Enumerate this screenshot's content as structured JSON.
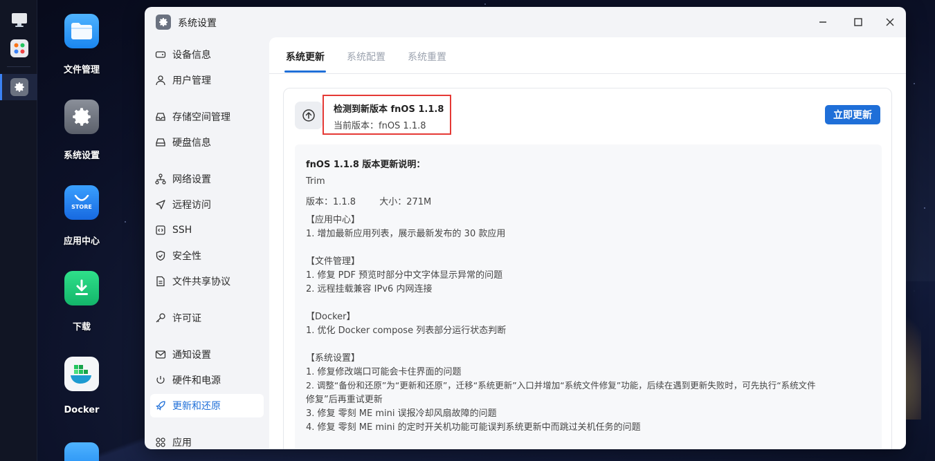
{
  "desktop": {
    "icons": [
      {
        "label": "文件管理"
      },
      {
        "label": "系统设置"
      },
      {
        "label": "应用中心",
        "badge": "STORE"
      },
      {
        "label": "下载"
      },
      {
        "label": "Docker"
      }
    ]
  },
  "window": {
    "title": "系统设置"
  },
  "sidebar": {
    "items": [
      {
        "label": "设备信息",
        "icon": "device-icon"
      },
      {
        "label": "用户管理",
        "icon": "user-icon"
      },
      {
        "label": "存储空间管理",
        "icon": "storage-icon"
      },
      {
        "label": "硬盘信息",
        "icon": "disk-icon"
      },
      {
        "label": "网络设置",
        "icon": "network-icon"
      },
      {
        "label": "远程访问",
        "icon": "send-icon"
      },
      {
        "label": "SSH",
        "icon": "code-icon"
      },
      {
        "label": "安全性",
        "icon": "shield-icon"
      },
      {
        "label": "文件共享协议",
        "icon": "file-icon"
      },
      {
        "label": "许可证",
        "icon": "key-icon"
      },
      {
        "label": "通知设置",
        "icon": "mail-icon"
      },
      {
        "label": "硬件和电源",
        "icon": "power-icon"
      },
      {
        "label": "更新和还原",
        "icon": "rocket-icon",
        "active": true
      },
      {
        "label": "应用",
        "icon": "apps-icon"
      }
    ]
  },
  "tabs": [
    {
      "label": "系统更新",
      "active": true
    },
    {
      "label": "系统配置"
    },
    {
      "label": "系统重置"
    }
  ],
  "update": {
    "title": "检测到新版本 fnOS 1.1.8",
    "current": "当前版本：fnOS 1.1.8",
    "button": "立即更新"
  },
  "notes": {
    "heading": "fnOS 1.1.8 版本更新说明：",
    "vendor": "Trim",
    "version": "版本：1.1.8",
    "size": "大小：271M",
    "lines": [
      "【应用中心】",
      "1. 增加最新应用列表，展示最新发布的 30 款应用",
      "",
      "【文件管理】",
      "1. 修复 PDF 预览时部分中文字体显示异常的问题",
      "2. 远程挂载兼容 IPv6 内网连接",
      "",
      "【Docker】",
      "1. 优化 Docker compose 列表部分运行状态判断",
      "",
      "【系统设置】",
      "1. 修复修改端口可能会卡住界面的问题",
      "2. 调整“备份和还原”为“更新和还原”，迁移“系统更新”入口并增加“系统文件修复”功能，后续在遇到更新失败时，可先执行“系统文件",
      "修复”后再重试更新",
      "3. 修复 零刻 ME mini 误报冷却风扇故障的问题",
      "4. 修复 零刻 ME mini 的定时开关机功能可能误判系统更新中而跳过关机任务的问题"
    ]
  },
  "colors": {
    "accent": "#1f6fd8",
    "highlight_border": "#e53935"
  }
}
